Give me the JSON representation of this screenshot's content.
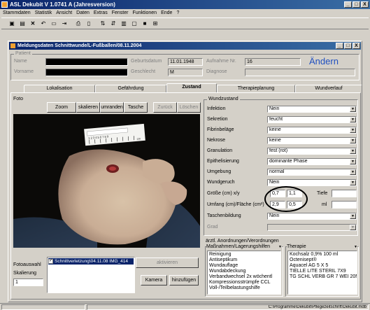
{
  "app": {
    "title": "ASL Dekubit V 1.0741 A (Jahresversion)"
  },
  "window_controls": {
    "minimize": "_",
    "restore": "□",
    "close": "X"
  },
  "menu": [
    "Stammdaten",
    "Statistik",
    "Ansicht",
    "Daten",
    "Extras",
    "Fenster",
    "Funktionen",
    "Ende",
    "?"
  ],
  "toolbar": {
    "icons": [
      "save-icon",
      "disk-icon",
      "delete-icon",
      "undo-icon",
      "open-icon",
      "exit-icon",
      "print-icon",
      "print-preview-icon",
      "sort-asc-icon",
      "sort-desc-icon",
      "filter-icon",
      "window-icon",
      "window-icon",
      "tile-icon"
    ]
  },
  "child_window": {
    "title": "Meldungsdaten Schnittwunde/L-Fußballen/08.11.2004",
    "controls": {
      "minimize": "_",
      "restore": "□",
      "close": "X"
    }
  },
  "patient": {
    "group_label": "Patient",
    "name_label": "Name",
    "vorname_label": "Vorname",
    "geburtsdatum_label": "Geburtsdatum",
    "geburtsdatum_value": "11.01.1948",
    "geschlecht_label": "Geschlecht",
    "geschlecht_value": "M",
    "aufnahme_label": "Aufnahme Nr.",
    "aufnahme_value": "16",
    "diagnose_label": "Diagnose",
    "aendern_label": "Ändern"
  },
  "tabs": [
    "Lokalisation",
    "Gefährdung",
    "Zustand",
    "Therapieplanung",
    "Wundverlauf"
  ],
  "active_tab": "Zustand",
  "foto": {
    "label": "Foto",
    "buttons": [
      "Zoom",
      "skalieren",
      "umranden",
      "Tasche",
      "Zurück",
      "Löschen"
    ],
    "fotoauswahl_label": "Fotoauswahl",
    "skalierung_label": "Skalierung",
    "skalierung_value": "1",
    "list_item": "Schnittverletzung\\04.11.08 IMG_414",
    "aktivieren_label": "aktivieren",
    "kamera_label": "Kamera",
    "hinzufuegen_label": "hinzufügen"
  },
  "wundzustand": {
    "group_label": "Wundzustand",
    "rows": [
      {
        "label": "Infektion",
        "value": "Nein"
      },
      {
        "label": "Sekretion",
        "value": "feucht"
      },
      {
        "label": "Fibrinbeläge",
        "value": "keine"
      },
      {
        "label": "Nekrose",
        "value": "keine"
      },
      {
        "label": "Granulation",
        "value": "fest (rot)"
      },
      {
        "label": "Epithelisierung",
        "value": "dominante Phase"
      },
      {
        "label": "Umgebung",
        "value": "normal"
      },
      {
        "label": "Wundgeruch",
        "value": "Nein"
      }
    ],
    "groesse_label": "Größe (cm) x/y",
    "groesse_x": "0,7",
    "groesse_y": "1,1",
    "tiefe_label": "Tiefe",
    "umfang_label": "Umfang (cm)/Fläche (cm²)",
    "umfang_value": "2,9",
    "flaeche_value": "0,5",
    "ml_label": "ml",
    "taschenbildung_label": "Taschenbildung",
    "taschenbildung_value": "Nein",
    "grad_label": "Grad"
  },
  "anordnungen": {
    "group_label": "ärztl. Anordnungen/Verordnungen",
    "massnahmen_label": "Maßnahmen/Lagerungshilfen",
    "massnahmen": [
      "Reinigung",
      "Antiseptikum",
      "Wundauflage",
      "Wundabdeckung",
      "Verbandwechsel 2x wöchentl",
      "Kompressionsstrümpfe CCL",
      "Voll-/Teilbelastungshilfe"
    ],
    "therapie_label": "Therapie",
    "therapie": [
      "Kochsalz 0,9% 100 ml",
      "Octenisept®",
      "Aquacel AG 5 X 5",
      "TIELLE LITE STERIL 7X9",
      "TG SCHL VERB GR 7 WEI 20M"
    ]
  },
  "statusbar": {
    "path": "C:\\Programme\\Dekubit\\Pflegezeitschrift\\Dekubit.mdb"
  },
  "photo": {
    "ruler_numbers": "1 2 3 4 5 6 7 8 9",
    "ruler_scale": "cm"
  }
}
